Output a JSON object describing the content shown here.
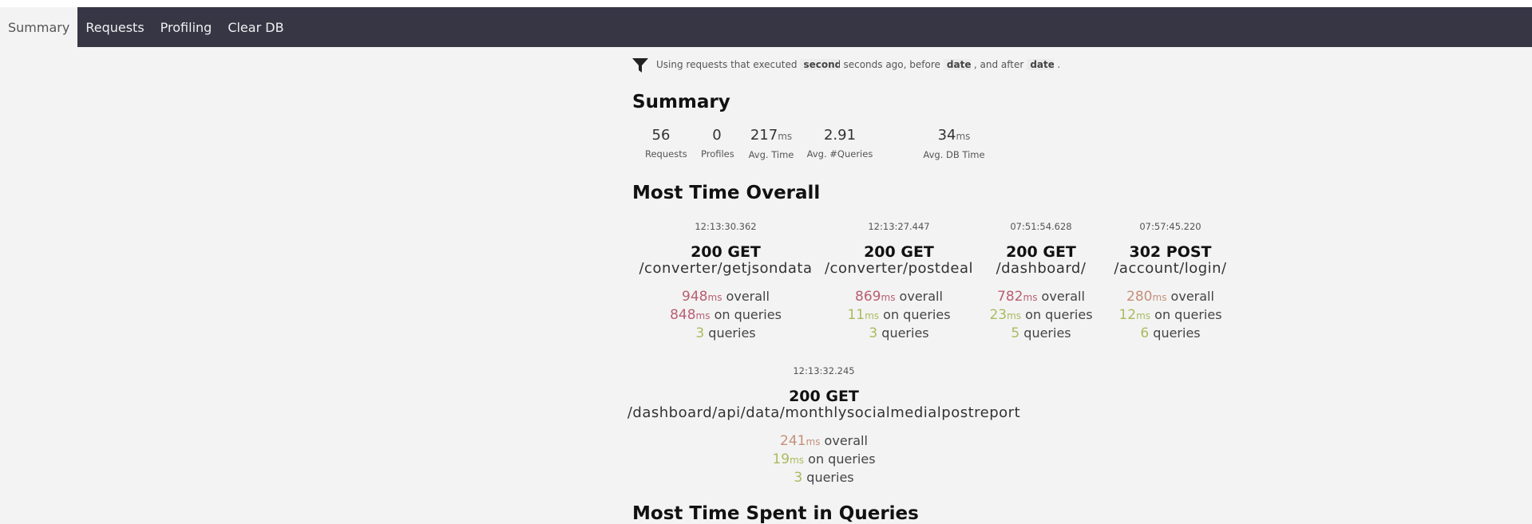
{
  "nav": {
    "items": [
      {
        "label": "Summary",
        "active": true
      },
      {
        "label": "Requests",
        "active": false
      },
      {
        "label": "Profiling",
        "active": false
      },
      {
        "label": "Clear DB",
        "active": false
      }
    ]
  },
  "filter": {
    "prefix": "Using requests that executed",
    "seconds_placeholder": "seconds",
    "middle": "seconds ago, before",
    "before_placeholder": "date",
    "connector": ", and after",
    "after_placeholder": "date",
    "suffix": "."
  },
  "summary": {
    "heading": "Summary",
    "stats": [
      {
        "value": "56",
        "unit": "",
        "label": "Requests"
      },
      {
        "value": "0",
        "unit": "",
        "label": "Profiles"
      },
      {
        "value": "217",
        "unit": "ms",
        "label": "Avg. Time"
      },
      {
        "value": "2.91",
        "unit": "",
        "label": "Avg. #Queries"
      },
      {
        "value": "34",
        "unit": "ms",
        "label": "Avg. DB Time"
      }
    ]
  },
  "most_time_overall": {
    "heading": "Most Time Overall",
    "requests": [
      {
        "timestamp": "12:13:30.362",
        "status": "200 GET",
        "path": "/converter/getjsondata",
        "overall": "948",
        "on_queries": "848",
        "queries": "3"
      },
      {
        "timestamp": "12:13:27.447",
        "status": "200 GET",
        "path": "/converter/postdeal",
        "overall": "869",
        "on_queries": "11",
        "queries": "3"
      },
      {
        "timestamp": "07:51:54.628",
        "status": "200 GET",
        "path": "/dashboard/",
        "overall": "782",
        "on_queries": "23",
        "queries": "5"
      },
      {
        "timestamp": "07:57:45.220",
        "status": "302 POST",
        "path": "/account/login/",
        "overall": "280",
        "on_queries": "12",
        "queries": "6"
      },
      {
        "timestamp": "12:13:32.245",
        "status": "200 GET",
        "path": "/dashboard/api/data/monthlysocialmedialpostreport",
        "overall": "241",
        "on_queries": "19",
        "queries": "3"
      }
    ],
    "labels": {
      "ms": "ms",
      "overall": "overall",
      "on_queries": "on queries",
      "queries": "queries"
    }
  },
  "next_section": {
    "heading": "Most Time Spent in Queries"
  },
  "colors": {
    "navbar_bg": "#363645",
    "page_bg": "#f3f3f3",
    "high_time": "#b85f72",
    "medium_time": "#c4907a",
    "low_time": "#a9bb5e"
  }
}
